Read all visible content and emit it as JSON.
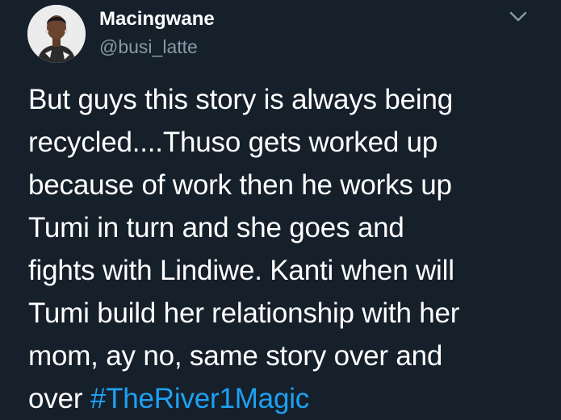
{
  "author": {
    "display_name": "Macingwane",
    "handle": "@busi_latte",
    "avatar_icon": "profile-photo"
  },
  "tweet": {
    "lines": [
      "But guys this story is always being",
      "recycled....Thuso gets worked up",
      "because of work then he works up",
      "Tumi in turn and she goes and",
      "fights with Lindiwe. Kanti when will",
      "Tumi build her relationship with her",
      "mom, ay no, same story over and"
    ],
    "last_line_prefix": "over ",
    "hashtag": "#TheRiver1Magic"
  },
  "menu_icon": "chevron-down-icon",
  "colors": {
    "background": "#15202b",
    "text": "#ffffff",
    "secondary": "#8899a6",
    "link": "#1da1f2"
  }
}
